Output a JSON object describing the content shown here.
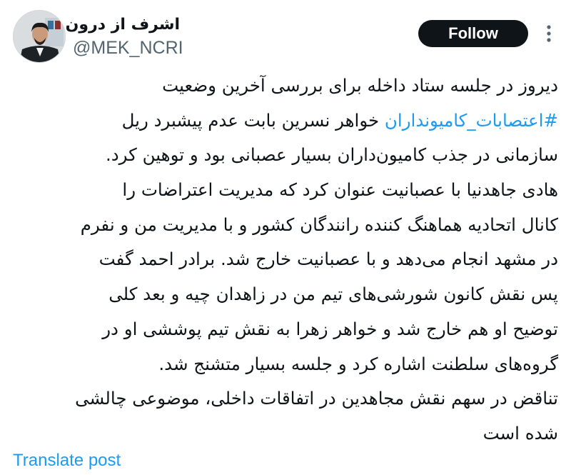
{
  "author": {
    "display_name": "اشرف از درون",
    "handle": "@MEK_NCRI"
  },
  "actions": {
    "follow_label": "Follow",
    "more_icon": "more-vertical-icon"
  },
  "tweet": {
    "lines": [
      {
        "text": "دیروز در جلسه ستاد داخله برای بررسی آخرین وضعیت"
      },
      {
        "hashtag": "#اعتصابات_کامیونداران",
        "text": " خواهر نسرین بابت عدم  پیشبرد ریل"
      },
      {
        "text": "سازمانی در جذب کامیون‌داران بسیار عصبانی بود و توهین کرد."
      },
      {
        "text": "هادی جاهدنیا با عصبانیت عنوان کرد که مدیریت اعتراضات را"
      },
      {
        "text": "کانال اتحادیه هماهنگ کننده رانندگان کشور و با مدیریت من و نفرم"
      },
      {
        "text": "در مشهد انجام می‌دهد و با عصبانیت خارج شد. برادر احمد گفت"
      },
      {
        "text": "پس نقش کانون شورشی‌های تیم من در زاهدان چیه و بعد کلی"
      },
      {
        "text": "توضیح او هم خارج شد و خواهر زهرا به نقش تیم پوششی او در"
      },
      {
        "text": "گروه‌های سلطنت اشاره کرد و جلسه بسیار متشنج شد."
      },
      {
        "text": "تناقض در سهم نقش مجاهدین در اتفاقات داخلی، موضوعی چالشی"
      },
      {
        "text": "شده است"
      }
    ]
  },
  "footer": {
    "translate_label": "Translate post"
  },
  "colors": {
    "accent": "#1d9bf0",
    "text_primary": "#0f1419",
    "text_secondary": "#536471",
    "button_bg": "#0f1419",
    "background": "#ffffff"
  }
}
